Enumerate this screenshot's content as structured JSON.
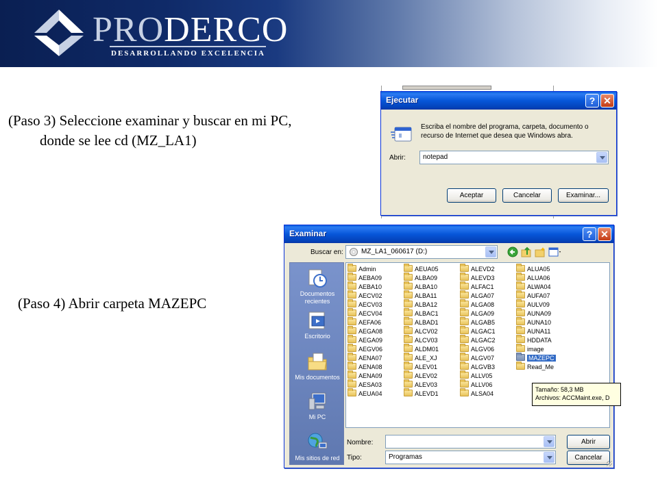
{
  "banner": {
    "brand_light": "PRO",
    "brand_bold": "DERCO",
    "tagline": "DESARROLLANDO EXCELENCIA",
    "colors": {
      "navy": "#0f2a68",
      "accent": "#c7d1e4"
    }
  },
  "steps": {
    "step3_line1": "(Paso 3) Seleccione examinar y buscar en mi PC,",
    "step3_line2": "donde se lee cd (MZ_LA1)",
    "step4": "(Paso 4) Abrir carpeta MAZEPC"
  },
  "run_dialog": {
    "title": "Ejecutar",
    "help_label": "?",
    "close_label": "✕",
    "description": "Escriba el nombre del programa, carpeta, documento o recurso de Internet que desea que Windows abra.",
    "open_label": "Abrir:",
    "open_value": "notepad",
    "ok_label": "Aceptar",
    "cancel_label": "Cancelar",
    "browse_label": "Examinar..."
  },
  "browse_dialog": {
    "title": "Examinar",
    "help_label": "?",
    "close_label": "✕",
    "look_in_label": "Buscar en:",
    "look_in_value": "MZ_LA1_060617 (D:)",
    "toolbar_icons": [
      "back-icon",
      "up-folder-icon",
      "new-folder-icon",
      "views-menu-icon"
    ],
    "places": [
      {
        "label": "Documentos recientes",
        "icon": "recent-documents-icon"
      },
      {
        "label": "Escritorio",
        "icon": "desktop-icon"
      },
      {
        "label": "Mis documentos",
        "icon": "my-documents-icon"
      },
      {
        "label": "Mi PC",
        "icon": "my-computer-icon"
      },
      {
        "label": "Mis sitios de red",
        "icon": "network-places-icon"
      }
    ],
    "columns": [
      [
        "Admin",
        "AEBA09",
        "AEBA10",
        "AECV02",
        "AECV03",
        "AECV04",
        "AEFA06",
        "AEGA08",
        "AEGA09",
        "AEGV06",
        "AENA07",
        "AENA08",
        "AENA09",
        "AESA03",
        "AEUA04"
      ],
      [
        "AEUA05",
        "ALBA09",
        "ALBA10",
        "ALBA11",
        "ALBA12",
        "ALBAC1",
        "ALBAD1",
        "ALCV02",
        "ALCV03",
        "ALDM01",
        "ALE_XJ",
        "ALEV01",
        "ALEV02",
        "ALEV03",
        "ALEVD1"
      ],
      [
        "ALEVD2",
        "ALEVD3",
        "ALFAC1",
        "ALGA07",
        "ALGA08",
        "ALGA09",
        "ALGAB5",
        "ALGAC1",
        "ALGAC2",
        "ALGV06",
        "ALGV07",
        "ALGVB3",
        "ALLV05",
        "ALLV06",
        "ALSA04"
      ],
      [
        "ALUA05",
        "ALUA06",
        "ALWA04",
        "AUFA07",
        "AULV09",
        "AUNA09",
        "AUNA10",
        "AUNA11",
        "HDDATA",
        "image",
        "MAZEPC",
        "Read_Me"
      ]
    ],
    "selected_folder": "MAZEPC",
    "tooltip_line1": "Tamaño: 58,3 MB",
    "tooltip_line2": "Archivos: ACCMaint.exe, D",
    "name_label": "Nombre:",
    "name_value": "",
    "type_label": "Tipo:",
    "type_value": "Programas",
    "open_button": "Abrir",
    "cancel_button": "Cancelar"
  }
}
